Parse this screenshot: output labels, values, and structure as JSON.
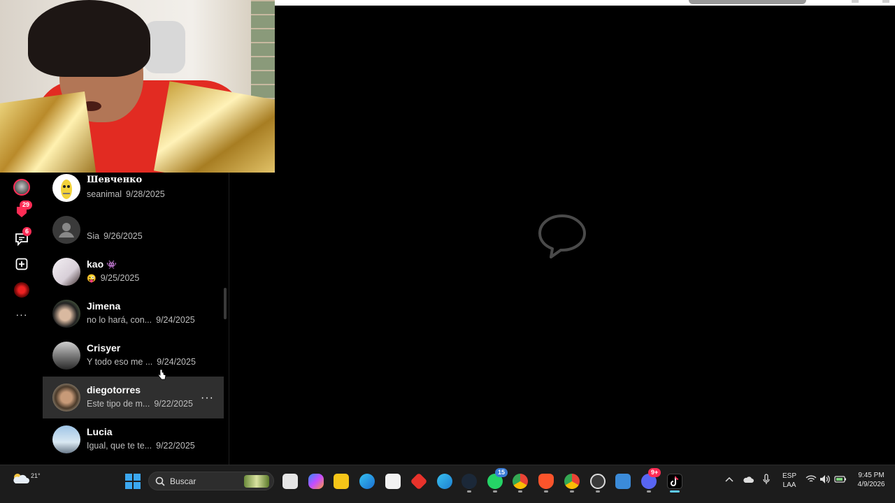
{
  "conversations": [
    {
      "name": "Шевченко",
      "preview": "seanimal",
      "date": "9/28/2025",
      "avatar": "banana"
    },
    {
      "name": "",
      "preview": "Sia",
      "date": "9/26/2025",
      "avatar": "default"
    },
    {
      "name": "kao",
      "name_emoji": "👾",
      "preview": "😜",
      "date": "9/25/2025",
      "avatar": "girl-pale"
    },
    {
      "name": "Jimena",
      "preview": "no lo hará, con...",
      "date": "9/24/2025",
      "avatar": "girl-dark"
    },
    {
      "name": "Crisyer",
      "preview": "Y todo eso me ...",
      "date": "9/24/2025",
      "avatar": "guy-mirror"
    },
    {
      "name": "diegotorres",
      "preview": "Este tipo de m...",
      "date": "9/22/2025",
      "avatar": "guy-selfie",
      "more": "···"
    },
    {
      "name": "Lucia",
      "preview": "Igual, que te te...",
      "date": "9/22/2025",
      "avatar": "sky"
    }
  ],
  "rail": {
    "notifications_count": "29",
    "messages_count": "6",
    "more": "···"
  },
  "taskbar": {
    "weather_temp": "21°",
    "search_placeholder": "Buscar",
    "whatsapp_badge": "15",
    "discord_badge": "9+",
    "lang_1": "ESP",
    "lang_2": "LAA",
    "time": "9:45 PM",
    "date": "4/9/2026"
  },
  "colors": {
    "accent": "#fe2c55",
    "hover_row": "#2f2f2f",
    "taskbar": "#1c1c1c"
  }
}
